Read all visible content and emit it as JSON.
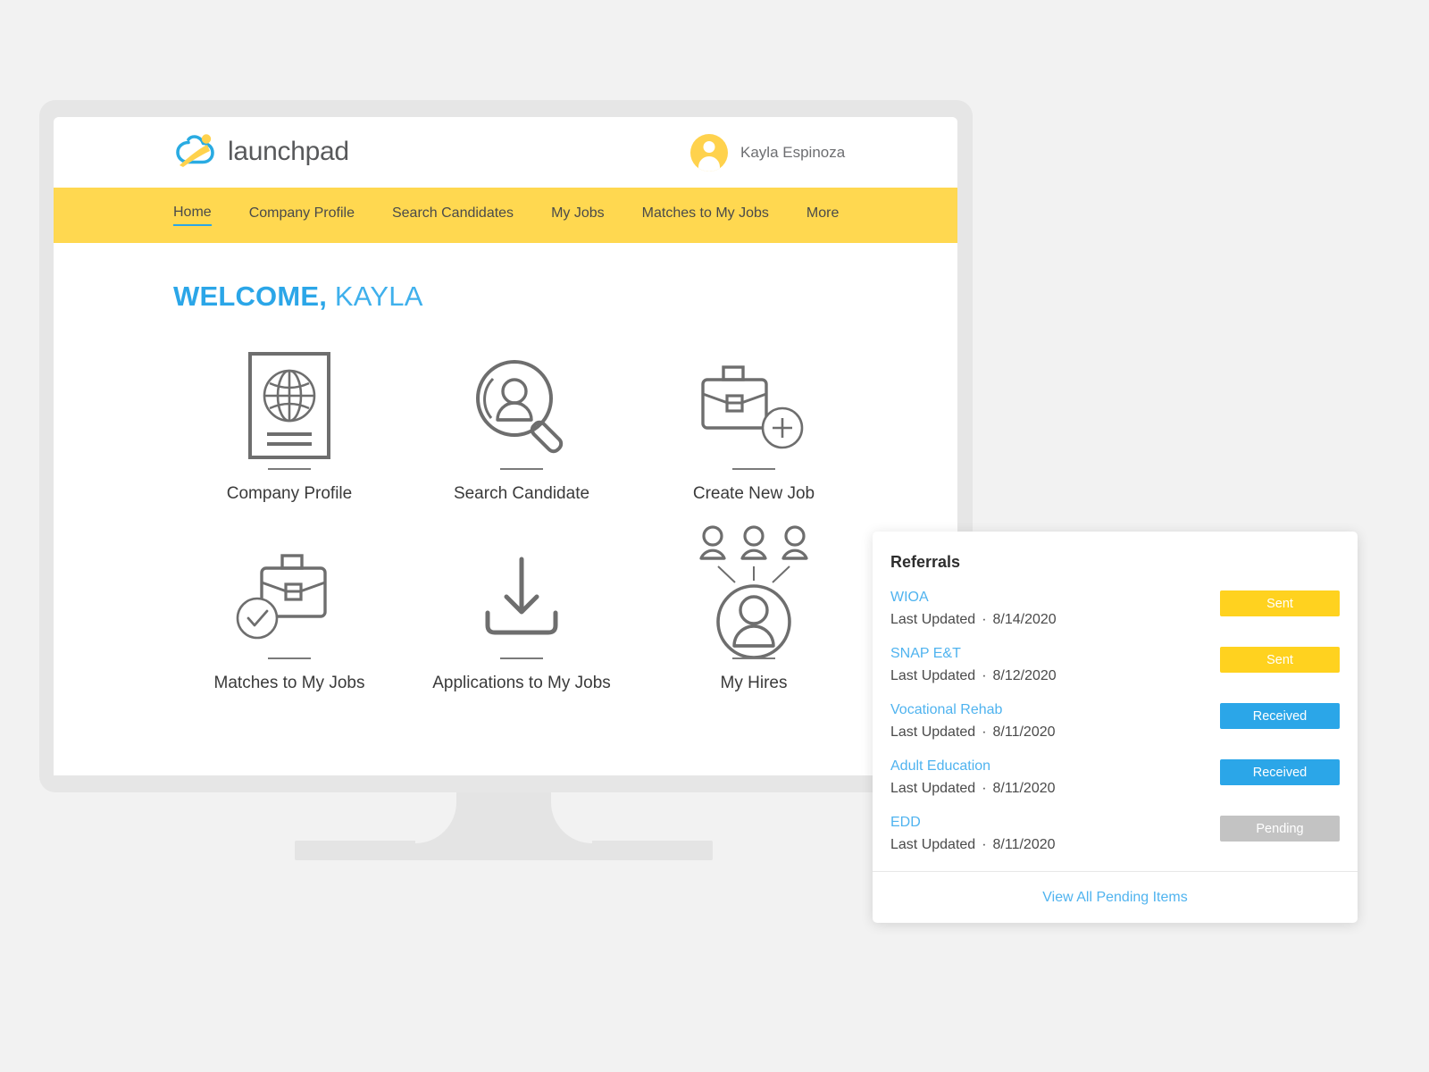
{
  "brand": {
    "name": "launchpad",
    "logo_icon": "launchpad-logo-icon",
    "colors": {
      "blue": "#29abe2",
      "yellow": "#ffd24d"
    }
  },
  "header": {
    "user_name": "Kayla Espinoza",
    "avatar_icon": "user-avatar-icon"
  },
  "nav": {
    "items": [
      {
        "label": "Home",
        "active": true
      },
      {
        "label": "Company Profile",
        "active": false
      },
      {
        "label": "Search Candidates",
        "active": false
      },
      {
        "label": "My Jobs",
        "active": false
      },
      {
        "label": "Matches to My Jobs",
        "active": false
      },
      {
        "label": "More",
        "active": false
      }
    ],
    "background": "#ffd850",
    "active_underline": "#2ba6e8"
  },
  "main": {
    "welcome_bold": "WELCOME,",
    "welcome_light": "KAYLA",
    "tiles": [
      {
        "label": "Company Profile",
        "icon": "document-globe-icon"
      },
      {
        "label": "Search Candidate",
        "icon": "magnifier-person-icon"
      },
      {
        "label": "Create New Job",
        "icon": "briefcase-plus-icon"
      },
      {
        "label": "Matches to My Jobs",
        "icon": "briefcase-check-icon"
      },
      {
        "label": "Applications to My Jobs",
        "icon": "download-tray-icon"
      },
      {
        "label": "My Hires",
        "icon": "people-network-icon"
      }
    ]
  },
  "referrals": {
    "title": "Referrals",
    "rows": [
      {
        "name": "WIOA",
        "updated_label": "Last Updated",
        "date": "8/14/2020",
        "status": "Sent",
        "status_color": "#ffd21f"
      },
      {
        "name": "SNAP E&T",
        "updated_label": "Last Updated",
        "date": "8/12/2020",
        "status": "Sent",
        "status_color": "#ffd21f"
      },
      {
        "name": "Vocational Rehab",
        "updated_label": "Last Updated",
        "date": "8/11/2020",
        "status": "Received",
        "status_color": "#2ba6e8"
      },
      {
        "name": "Adult Education",
        "updated_label": "Last Updated",
        "date": "8/11/2020",
        "status": "Received",
        "status_color": "#2ba6e8"
      },
      {
        "name": "EDD",
        "updated_label": "Last Updated",
        "date": "8/11/2020",
        "status": "Pending",
        "status_color": "#c3c3c3"
      }
    ],
    "footer_link": "View All Pending Items"
  }
}
